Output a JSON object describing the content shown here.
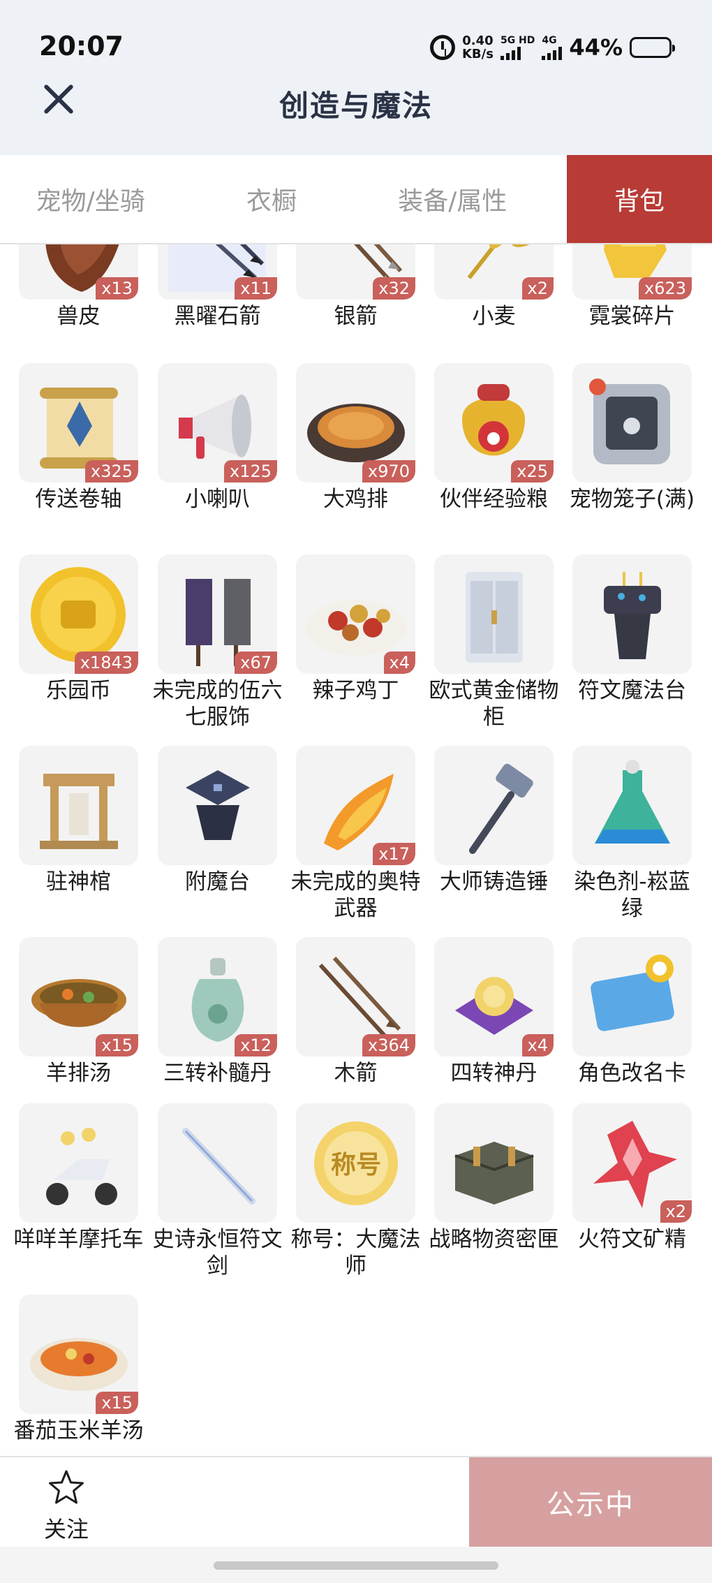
{
  "status_bar": {
    "time": "20:07",
    "net_speed_value": "0.40",
    "net_speed_unit": "KB/s",
    "signal_1": "5G HD",
    "signal_2": "4G",
    "battery_percent": "44%",
    "battery_level": 0.44
  },
  "header": {
    "title": "创造与魔法",
    "close_icon": "close-icon"
  },
  "tabs": [
    {
      "label": "宠物/坐骑",
      "active": false
    },
    {
      "label": "衣橱",
      "active": false
    },
    {
      "label": "装备/属性",
      "active": false
    },
    {
      "label": "背包",
      "active": true
    }
  ],
  "accent_color": "#b83b36",
  "items": [
    {
      "name": "兽皮",
      "count": "x13",
      "icon": "hide-icon"
    },
    {
      "name": "黑曜石箭",
      "count": "x11",
      "icon": "obsidian-arrow-icon"
    },
    {
      "name": "银箭",
      "count": "x32",
      "icon": "silver-arrow-icon"
    },
    {
      "name": "小麦",
      "count": "x2",
      "icon": "wheat-icon"
    },
    {
      "name": "霓裳碎片",
      "count": "x623",
      "icon": "garment-shard-icon"
    },
    {
      "name": "传送卷轴",
      "count": "x325",
      "icon": "scroll-icon"
    },
    {
      "name": "小喇叭",
      "count": "x125",
      "icon": "megaphone-icon"
    },
    {
      "name": "大鸡排",
      "count": "x970",
      "icon": "chicken-cutlet-icon"
    },
    {
      "name": "伙伴经验粮",
      "count": "x25",
      "icon": "food-bag-icon"
    },
    {
      "name": "宠物笼子(满)",
      "count": "",
      "icon": "pet-cage-icon"
    },
    {
      "name": "乐园币",
      "count": "x1843",
      "icon": "coin-icon"
    },
    {
      "name": "未完成的伍六七服饰",
      "count": "x67",
      "icon": "costume-icon"
    },
    {
      "name": "辣子鸡丁",
      "count": "x4",
      "icon": "spicy-chicken-icon"
    },
    {
      "name": "欧式黄金储物柜",
      "count": "",
      "icon": "cabinet-icon"
    },
    {
      "name": "符文魔法台",
      "count": "",
      "icon": "rune-altar-icon"
    },
    {
      "name": "驻神棺",
      "count": "",
      "icon": "shrine-icon"
    },
    {
      "name": "附魔台",
      "count": "",
      "icon": "enchant-table-icon"
    },
    {
      "name": "未完成的奥特武器",
      "count": "x17",
      "icon": "flame-weapon-icon"
    },
    {
      "name": "大师铸造锤",
      "count": "",
      "icon": "hammer-icon"
    },
    {
      "name": "染色剂-崧蓝绿",
      "count": "",
      "icon": "dye-flask-icon"
    },
    {
      "name": "羊排汤",
      "count": "x15",
      "icon": "soup-icon"
    },
    {
      "name": "三转补髓丹",
      "count": "x12",
      "icon": "potion-bottle-icon"
    },
    {
      "name": "木箭",
      "count": "x364",
      "icon": "wooden-arrow-icon"
    },
    {
      "name": "四转神丹",
      "count": "x4",
      "icon": "pill-cushion-icon"
    },
    {
      "name": "角色改名卡",
      "count": "",
      "icon": "rename-card-icon"
    },
    {
      "name": "咩咩羊摩托车",
      "count": "",
      "icon": "scooter-icon"
    },
    {
      "name": "史诗永恒符文剑",
      "count": "",
      "icon": "rune-sword-icon"
    },
    {
      "name": "称号：大魔法师",
      "count": "",
      "icon": "title-badge-icon",
      "badge_text": "称号"
    },
    {
      "name": "战略物资密匣",
      "count": "",
      "icon": "supply-crate-icon"
    },
    {
      "name": "火符文矿精",
      "count": "x2",
      "icon": "fire-crystal-icon"
    },
    {
      "name": "番茄玉米羊汤",
      "count": "x15",
      "icon": "stew-icon"
    }
  ],
  "bottom_bar": {
    "follow_label": "关注",
    "follow_icon": "star-icon",
    "publish_label": "公示中"
  }
}
